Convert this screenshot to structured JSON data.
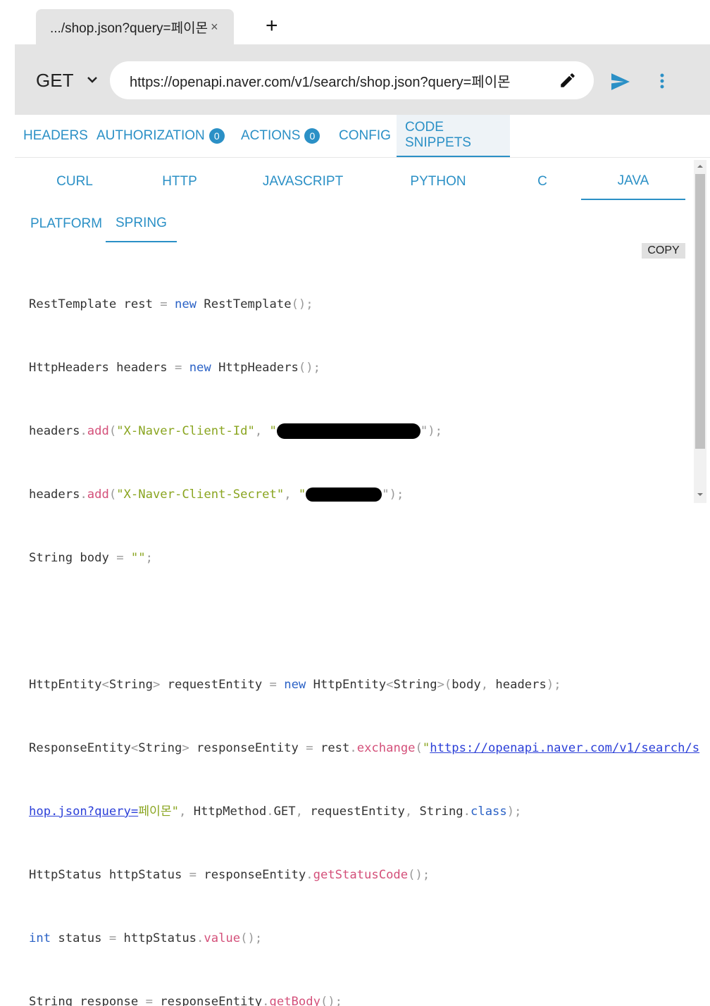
{
  "tabs": {
    "active_title": ".../shop.json?query=페이몬",
    "close_glyph": "×",
    "new_tab_glyph": "+"
  },
  "request": {
    "method": "GET",
    "url": "https://openapi.naver.com/v1/search/shop.json?query=페이몬"
  },
  "main_tabs": [
    {
      "label": "HEADERS"
    },
    {
      "label": "AUTHORIZATION",
      "badge": "0"
    },
    {
      "label": "ACTIONS",
      "badge": "0"
    },
    {
      "label": "CONFIG"
    },
    {
      "label": "CODE SNIPPETS",
      "active": true
    }
  ],
  "lang_tabs": [
    "CURL",
    "HTTP",
    "JAVASCRIPT",
    "PYTHON",
    "C",
    "JAVA"
  ],
  "active_lang": "JAVA",
  "sub_tabs": [
    "PLATFORM",
    "SPRING"
  ],
  "active_sub": "SPRING",
  "copy_label": "COPY",
  "code": {
    "l1": [
      "RestTemplate rest ",
      "=",
      " ",
      "new",
      " RestTemplate",
      "();"
    ],
    "l2": [
      "HttpHeaders headers ",
      "=",
      " ",
      "new",
      " HttpHeaders",
      "();"
    ],
    "l3": [
      "headers",
      ".",
      "add",
      "(",
      "\"X-Naver-Client-Id\"",
      ",",
      " \"",
      "\");"
    ],
    "l4": [
      "headers",
      ".",
      "add",
      "(",
      "\"X-Naver-Client-Secret\"",
      ",",
      " \"",
      "\");"
    ],
    "l5": [
      "String body ",
      "=",
      " ",
      "\"\"",
      ";"
    ],
    "l7": [
      "HttpEntity",
      "<",
      "String",
      ">",
      " requestEntity ",
      "=",
      " ",
      "new",
      " HttpEntity",
      "<",
      "String",
      ">",
      "(",
      "body",
      ",",
      " headers",
      ");"
    ],
    "l8": [
      "ResponseEntity",
      "<",
      "String",
      ">",
      " responseEntity ",
      "=",
      " rest",
      ".",
      "exchange",
      "(",
      "\"",
      "https://openapi.naver.com/v1/search/s"
    ],
    "l9": [
      "hop.json?query=",
      "페이몬\"",
      ",",
      " HttpMethod",
      ".",
      "GET",
      ",",
      " requestEntity",
      ",",
      " String",
      ".",
      "class",
      ");"
    ],
    "l10": [
      "HttpStatus httpStatus ",
      "=",
      " responseEntity",
      ".",
      "getStatusCode",
      "();"
    ],
    "l11": [
      "int",
      " status ",
      "=",
      " httpStatus",
      ".",
      "value",
      "();"
    ],
    "l12": [
      "String response ",
      "=",
      " responseEntity",
      ".",
      "getBody",
      "();"
    ]
  },
  "colors": {
    "accent": "#2b90c6",
    "keyword": "#2b62c6",
    "function": "#d4507a",
    "string": "#8aa520",
    "bar_bg": "#e4e4e4"
  }
}
